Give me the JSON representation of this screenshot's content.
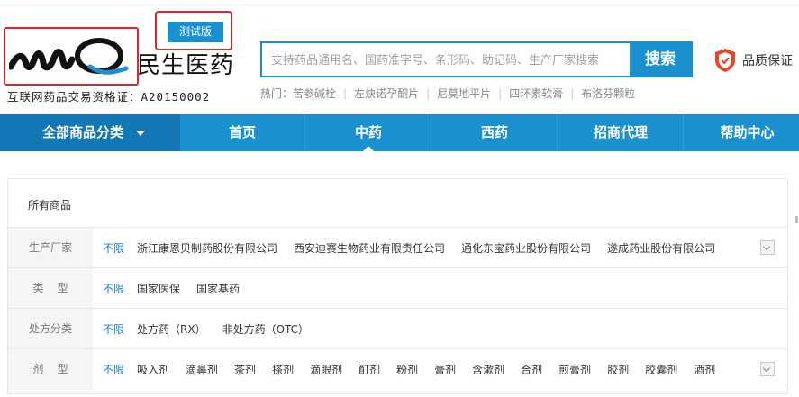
{
  "header": {
    "brand_name": "民生医药",
    "license": "互联网药品交易资格证：A20150002",
    "beta_label": "测试版",
    "quality_label": "品质保证"
  },
  "search": {
    "placeholder": "支持药品通用名、国药准字号、条形码、助记码、生产厂家搜索",
    "button_label": "搜索",
    "hot_prefix": "热门：",
    "hot_items": [
      "苦参碱栓",
      "左炔诺孕酮片",
      "尼莫地平片",
      "四环素软膏",
      "布洛芬颗粒"
    ]
  },
  "nav": {
    "all_categories": "全部商品分类",
    "items": [
      "首页",
      "中药",
      "西药",
      "招商代理",
      "帮助中心"
    ],
    "active": "中药"
  },
  "filters": {
    "title": "所有商品",
    "rows": [
      {
        "label": "生产厂家",
        "none": "不限",
        "options": [
          "浙江康恩贝制药股份有限公司",
          "西安迪赛生物药业有限责任公司",
          "通化东宝药业股份有限公司",
          "遂成药业股份有限公司"
        ]
      },
      {
        "label": "类    型",
        "none": "不限",
        "options": [
          "国家医保",
          "国家基药"
        ]
      },
      {
        "label": "处方分类",
        "none": "不限",
        "options": [
          "处方药（RX）",
          "非处方药（OTC）"
        ]
      },
      {
        "label": "剂    型",
        "none": "不限",
        "options": [
          "吸入剂",
          "滴鼻剂",
          "茶剂",
          "搽剂",
          "滴眼剂",
          "酊剂",
          "粉剂",
          "膏剂",
          "含漱剂",
          "合剂",
          "煎膏剂",
          "胶剂",
          "胶囊剂",
          "酒剂"
        ]
      }
    ]
  },
  "colors": {
    "accent": "#1a90cf",
    "accent_dark": "#1177b5",
    "highlight": "#d9272e",
    "shield": "#e8462b"
  }
}
